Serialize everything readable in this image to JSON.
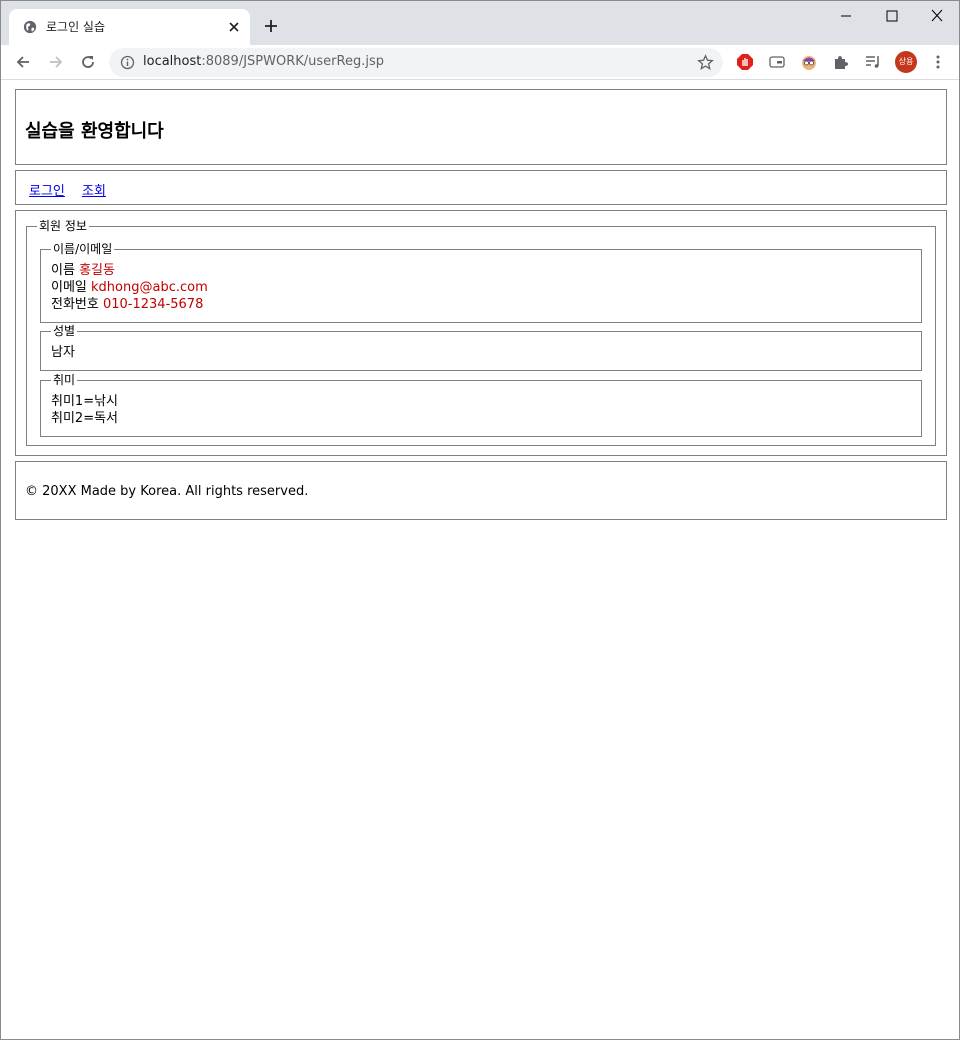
{
  "browser": {
    "tab_title": "로그인 실습",
    "url_host": "localhost",
    "url_rest": ":8089/JSPWORK/userReg.jsp",
    "profile_label": "상용"
  },
  "page": {
    "header_title": "실습을 환영합니다",
    "nav": {
      "login": "로그인",
      "lookup": "조회"
    },
    "member_info": {
      "legend": "회원 정보",
      "name_email": {
        "legend": "이름/이메일",
        "name_label": "이름",
        "name_value": "홍길동",
        "email_label": "이메일",
        "email_value": "kdhong@abc.com",
        "phone_label": "전화번호",
        "phone_value": "010-1234-5678"
      },
      "gender": {
        "legend": "성별",
        "value": "남자"
      },
      "hobby": {
        "legend": "취미",
        "items": [
          "취미1=낚시",
          "취미2=독서"
        ]
      }
    },
    "footer": "© 20XX Made by Korea. All rights reserved."
  },
  "colors": {
    "value_red": "#c00000",
    "link_blue": "#0000ee",
    "avatar_bg": "#c5361a"
  },
  "icons": [
    "globe-icon",
    "close-icon",
    "plus-icon",
    "back-icon",
    "forward-icon",
    "reload-icon",
    "info-icon",
    "star-icon",
    "menu-icon"
  ]
}
